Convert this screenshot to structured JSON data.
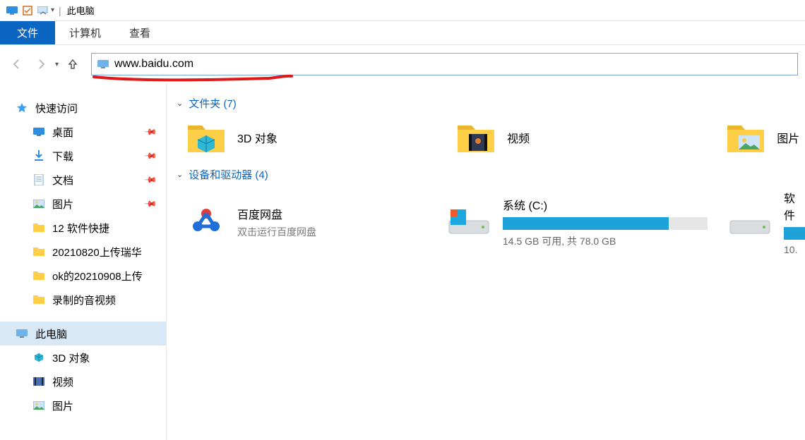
{
  "titlebar": {
    "title": "此电脑"
  },
  "ribbon": {
    "file": "文件",
    "computer": "计算机",
    "view": "查看"
  },
  "addressbar": {
    "text": "www.baidu.com"
  },
  "sidebar": {
    "quick_access": "快速访问",
    "desktop": "桌面",
    "downloads": "下载",
    "documents": "文档",
    "pictures": "图片",
    "q1": "12 软件快捷",
    "q2": "20210820上传瑞华",
    "q3": "ok的20210908上传",
    "q4": "录制的音视频",
    "this_pc": "此电脑",
    "pc_3d": "3D 对象",
    "pc_videos": "视频",
    "pc_pictures": "图片"
  },
  "content": {
    "folders_header": "文件夹 (7)",
    "devices_header": "设备和驱动器 (4)",
    "folder_3d": "3D 对象",
    "folder_videos": "视频",
    "folder_pictures": "图片",
    "baidu_name": "百度网盘",
    "baidu_sub": "双击运行百度网盘",
    "drive_c_name": "系统 (C:)",
    "drive_c_usage": "14.5 GB 可用,  共 78.0 GB",
    "drive_c_fill_pct": 81,
    "drive2_name": "软件",
    "drive2_usage": "10."
  }
}
